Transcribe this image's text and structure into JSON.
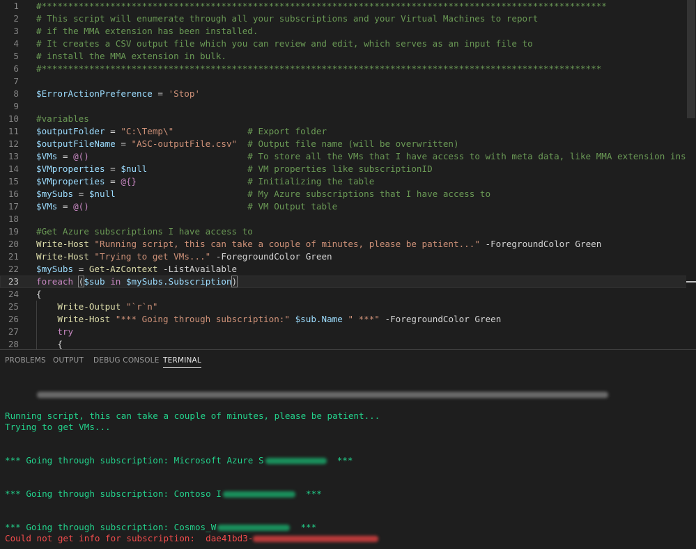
{
  "editor": {
    "current_line": 23,
    "lines": [
      {
        "n": "1",
        "segs": [
          {
            "t": "#***********************************************************************************************************",
            "c": "com"
          }
        ]
      },
      {
        "n": "2",
        "segs": [
          {
            "t": "# This script will enumerate through all your subscriptions and your Virtual Machines to report",
            "c": "com"
          }
        ]
      },
      {
        "n": "3",
        "segs": [
          {
            "t": "# if the MMA extension has been installed.",
            "c": "com"
          }
        ]
      },
      {
        "n": "4",
        "segs": [
          {
            "t": "# It creates a CSV output file which you can review and edit, which serves as an input file to",
            "c": "com"
          }
        ]
      },
      {
        "n": "5",
        "segs": [
          {
            "t": "# install the MMA extension in bulk.",
            "c": "com"
          }
        ]
      },
      {
        "n": "6",
        "segs": [
          {
            "t": "#**********************************************************************************************************",
            "c": "com"
          }
        ]
      },
      {
        "n": "7",
        "segs": []
      },
      {
        "n": "8",
        "segs": [
          {
            "t": "$ErrorActionPreference",
            "c": "var"
          },
          {
            "t": " = ",
            "c": "txt"
          },
          {
            "t": "'Stop'",
            "c": "str"
          }
        ]
      },
      {
        "n": "9",
        "segs": []
      },
      {
        "n": "10",
        "segs": [
          {
            "t": "#variables",
            "c": "com"
          }
        ]
      },
      {
        "n": "11",
        "segs": [
          {
            "t": "$outputFolder",
            "c": "var"
          },
          {
            "t": " = ",
            "c": "txt"
          },
          {
            "t": "\"C:\\Temp\\\"",
            "c": "str"
          },
          {
            "t": "              # Export folder",
            "c": "com"
          }
        ]
      },
      {
        "n": "12",
        "segs": [
          {
            "t": "$outputFileName",
            "c": "var"
          },
          {
            "t": " = ",
            "c": "txt"
          },
          {
            "t": "\"ASC-outputFile.csv\"",
            "c": "str"
          },
          {
            "t": "  # Output file name (will be overwritten)",
            "c": "com"
          }
        ]
      },
      {
        "n": "13",
        "segs": [
          {
            "t": "$VMs",
            "c": "var"
          },
          {
            "t": " = ",
            "c": "txt"
          },
          {
            "t": "@()",
            "c": "kw"
          },
          {
            "t": "                              # To store all the VMs that I have access to with meta data, like MMA extension installed",
            "c": "com"
          }
        ]
      },
      {
        "n": "14",
        "segs": [
          {
            "t": "$VMproperties",
            "c": "var"
          },
          {
            "t": " = ",
            "c": "txt"
          },
          {
            "t": "$null",
            "c": "var"
          },
          {
            "t": "                   # VM properties like subscriptionID",
            "c": "com"
          }
        ]
      },
      {
        "n": "15",
        "segs": [
          {
            "t": "$VMproperties",
            "c": "var"
          },
          {
            "t": " = ",
            "c": "txt"
          },
          {
            "t": "@{}",
            "c": "kw"
          },
          {
            "t": "                     # Initializing the table",
            "c": "com"
          }
        ]
      },
      {
        "n": "16",
        "segs": [
          {
            "t": "$mySubs",
            "c": "var"
          },
          {
            "t": " = ",
            "c": "txt"
          },
          {
            "t": "$null",
            "c": "var"
          },
          {
            "t": "                         # My Azure subscriptions that I have access to",
            "c": "com"
          }
        ]
      },
      {
        "n": "17",
        "segs": [
          {
            "t": "$VMs",
            "c": "var"
          },
          {
            "t": " = ",
            "c": "txt"
          },
          {
            "t": "@()",
            "c": "kw"
          },
          {
            "t": "                              # VM Output table",
            "c": "com"
          }
        ]
      },
      {
        "n": "18",
        "segs": []
      },
      {
        "n": "19",
        "segs": [
          {
            "t": "#Get Azure subscriptions I have access to",
            "c": "com"
          }
        ]
      },
      {
        "n": "20",
        "segs": [
          {
            "t": "Write-Host",
            "c": "fn"
          },
          {
            "t": " ",
            "c": "txt"
          },
          {
            "t": "\"Running script, this can take a couple of minutes, please be patient...\"",
            "c": "str"
          },
          {
            "t": " -ForegroundColor Green",
            "c": "txt"
          }
        ]
      },
      {
        "n": "21",
        "segs": [
          {
            "t": "Write-Host",
            "c": "fn"
          },
          {
            "t": " ",
            "c": "txt"
          },
          {
            "t": "\"Trying to get VMs...\"",
            "c": "str"
          },
          {
            "t": " -ForegroundColor Green",
            "c": "txt"
          }
        ]
      },
      {
        "n": "22",
        "segs": [
          {
            "t": "$mySubs",
            "c": "var"
          },
          {
            "t": " = ",
            "c": "txt"
          },
          {
            "t": "Get-AzContext",
            "c": "fn"
          },
          {
            "t": " -ListAvailable",
            "c": "txt"
          }
        ]
      },
      {
        "n": "23",
        "segs": [
          {
            "t": "foreach",
            "c": "kw"
          },
          {
            "t": " ",
            "c": "txt"
          },
          {
            "t": "(",
            "c": "txt",
            "m": 1
          },
          {
            "t": "$sub",
            "c": "var"
          },
          {
            "t": " in ",
            "c": "kw"
          },
          {
            "t": "$mySubs",
            "c": "var"
          },
          {
            "t": ".Subscription",
            "c": "var"
          },
          {
            "t": ")",
            "c": "txt",
            "m": 1
          }
        ]
      },
      {
        "n": "24",
        "segs": [
          {
            "t": "{",
            "c": "txt"
          }
        ]
      },
      {
        "n": "25",
        "segs": [
          {
            "t": "    ",
            "c": "txt"
          },
          {
            "t": "Write-Output",
            "c": "fn"
          },
          {
            "t": " ",
            "c": "txt"
          },
          {
            "t": "\"`r`n\"",
            "c": "str"
          }
        ]
      },
      {
        "n": "26",
        "segs": [
          {
            "t": "    ",
            "c": "txt"
          },
          {
            "t": "Write-Host",
            "c": "fn"
          },
          {
            "t": " ",
            "c": "txt"
          },
          {
            "t": "\"*** Going through subscription:\"",
            "c": "str"
          },
          {
            "t": " ",
            "c": "txt"
          },
          {
            "t": "$sub",
            "c": "var"
          },
          {
            "t": ".Name",
            "c": "var"
          },
          {
            "t": " ",
            "c": "txt"
          },
          {
            "t": "\" ***\"",
            "c": "str"
          },
          {
            "t": " -ForegroundColor Green",
            "c": "txt"
          }
        ]
      },
      {
        "n": "27",
        "segs": [
          {
            "t": "    ",
            "c": "txt"
          },
          {
            "t": "try",
            "c": "kw"
          }
        ]
      },
      {
        "n": "28",
        "segs": [
          {
            "t": "    ",
            "c": "txt"
          },
          {
            "t": "{",
            "c": "txt"
          }
        ]
      }
    ]
  },
  "panel": {
    "tabs": [
      {
        "label": "PROBLEMS",
        "active": false
      },
      {
        "label": "OUTPUT",
        "active": false
      },
      {
        "label": "DEBUG CONSOLE",
        "active": false
      },
      {
        "label": "TERMINAL",
        "active": true
      }
    ]
  },
  "terminal": {
    "line_running": "Running script, this can take a couple of minutes, please be patient...",
    "line_trying": "Trying to get VMs...",
    "sub1_prefix": "*** Going through subscription: Microsoft Azure S",
    "sub1_suffix": "***",
    "sub2_prefix": "*** Going through subscription: Contoso I",
    "sub2_suffix": "***",
    "sub3_prefix": "*** Going through subscription: Cosmos_W",
    "sub3_suffix": "***",
    "error_prefix": "Could not get info for subscription:  dae41bd3-",
    "colors": {
      "green": "#23d18b",
      "red": "#f14c4c"
    }
  }
}
